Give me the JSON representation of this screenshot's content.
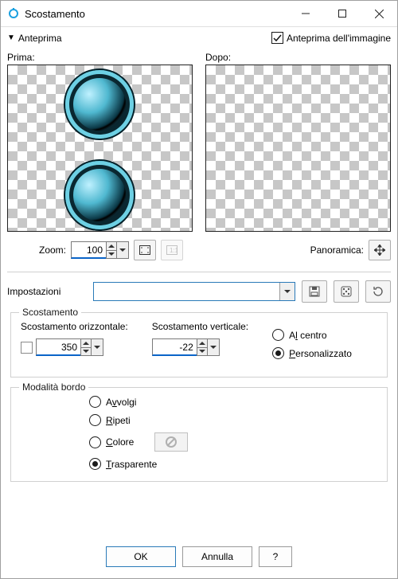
{
  "window": {
    "title": "Scostamento"
  },
  "anteprima": {
    "toggle_label": "Anteprima",
    "image_preview_label": "Anteprima dell'immagine",
    "image_preview_checked": true
  },
  "previews": {
    "before_label": "Prima:",
    "after_label": "Dopo:"
  },
  "zoom": {
    "label": "Zoom:",
    "value": "100",
    "pan_label": "Panoramica:"
  },
  "settings": {
    "label": "Impostazioni",
    "preset_value": ""
  },
  "offset_group": {
    "legend": "Scostamento",
    "horizontal_label": "Scostamento orizzontale:",
    "horizontal_value": "350",
    "vertical_label": "Scostamento verticale:",
    "vertical_value": "-22",
    "center_label_pre": "A",
    "center_label_ul": "l",
    "center_label_post": " centro",
    "custom_label_ul": "P",
    "custom_label_post": "ersonalizzato",
    "selected": "custom"
  },
  "edge_group": {
    "legend": "Modalità bordo",
    "options": {
      "wrap_pre": "A",
      "wrap_ul": "v",
      "wrap_post": "volgi",
      "repeat_ul": "R",
      "repeat_post": "ipeti",
      "color_ul": "C",
      "color_post": "olore",
      "transparent_ul": "T",
      "transparent_post": "rasparente"
    },
    "selected": "transparent"
  },
  "buttons": {
    "ok": "OK",
    "cancel": "Annulla",
    "help": "?"
  }
}
